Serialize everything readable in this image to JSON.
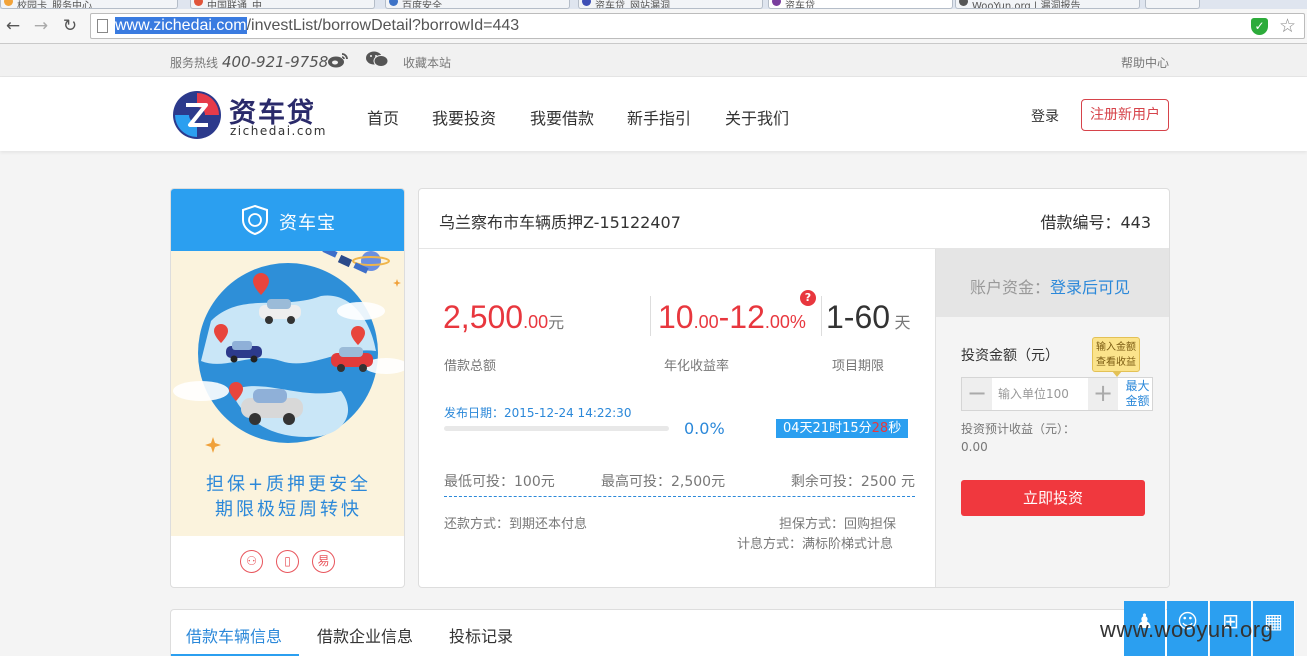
{
  "browser": {
    "tabs": [
      "校园卡_服务中心",
      "中国联通_中",
      "百度安全_",
      "资车贷_网站漏洞",
      "资车贷",
      "WooYun.org | 漏洞报告"
    ],
    "url_host": "www.zichedai.com",
    "url_path": "/investList/borrowDetail?borrowId=443",
    "back_icon": "←",
    "forward_icon": "→",
    "reload_icon": "↻",
    "shield_icon": "✓",
    "star_icon": "☆"
  },
  "topbar": {
    "hotline_label": "服务热线",
    "hotline_number": "400-921-9758",
    "favorite": "收藏本站",
    "help": "帮助中心"
  },
  "header": {
    "logo_cn": "资车贷",
    "logo_en": "zichedai.com",
    "menu": [
      "首页",
      "我要投资",
      "我要借款",
      "新手指引",
      "关于我们"
    ],
    "login": "登录",
    "register": "注册新用户"
  },
  "promo": {
    "title": "资车宝",
    "slogan_1": "担保+质押更安全",
    "slogan_2": "期限极短周转快",
    "icons": [
      "⚇",
      "▯",
      "易"
    ]
  },
  "loan": {
    "title": "乌兰察布市车辆质押Z-15122407",
    "number_label": "借款编号：443",
    "amount_int": "2,500",
    "amount_dec": ".00",
    "amount_unit": "元",
    "amount_label": "借款总额",
    "rate_a": "10",
    "rate_a_dec": ".00",
    "rate_sep": "-",
    "rate_b": "12",
    "rate_b_dec": ".00%",
    "rate_label": "年化收益率",
    "term": "1-60",
    "term_unit": "天",
    "term_label": "项目期限",
    "help_icon": "?",
    "publish_date": "发布日期：2015-12-24 14:22:30",
    "progress_percent": 0.0,
    "progress_text": "0.0%",
    "countdown_main": "04天21时15分",
    "countdown_sec": "28",
    "countdown_suffix": "秒",
    "min_invest": "最低可投：100元",
    "max_invest": "最高可投：2,500元",
    "remaining": "剩余可投：2500 元",
    "repay_method": "还款方式：到期还本付息",
    "guarantee": "担保方式：回购担保",
    "interest_method": "计息方式：满标阶梯式计息"
  },
  "invest_panel": {
    "account_label": "账户资金：",
    "account_link": "登录后可见",
    "amount_label": "投资金额（元）",
    "tooltip_1": "输入金额",
    "tooltip_2": "查看收益",
    "minus": "−",
    "plus": "+",
    "input_placeholder": "输入单位100",
    "max_line_1": "最大",
    "max_line_2": "金额",
    "estimate_label": "投资预计收益（元）：",
    "estimate_value": "0.00",
    "invest_button": "立即投资"
  },
  "detail_tabs": [
    "借款车辆信息",
    "借款企业信息",
    "投标记录"
  ],
  "float_icons": [
    "♟",
    "☺",
    "⊞",
    "▦"
  ],
  "watermark": "www.wooyun.org",
  "colors": {
    "brand_blue": "#2b9ff0",
    "brand_red": "#e8373e"
  }
}
